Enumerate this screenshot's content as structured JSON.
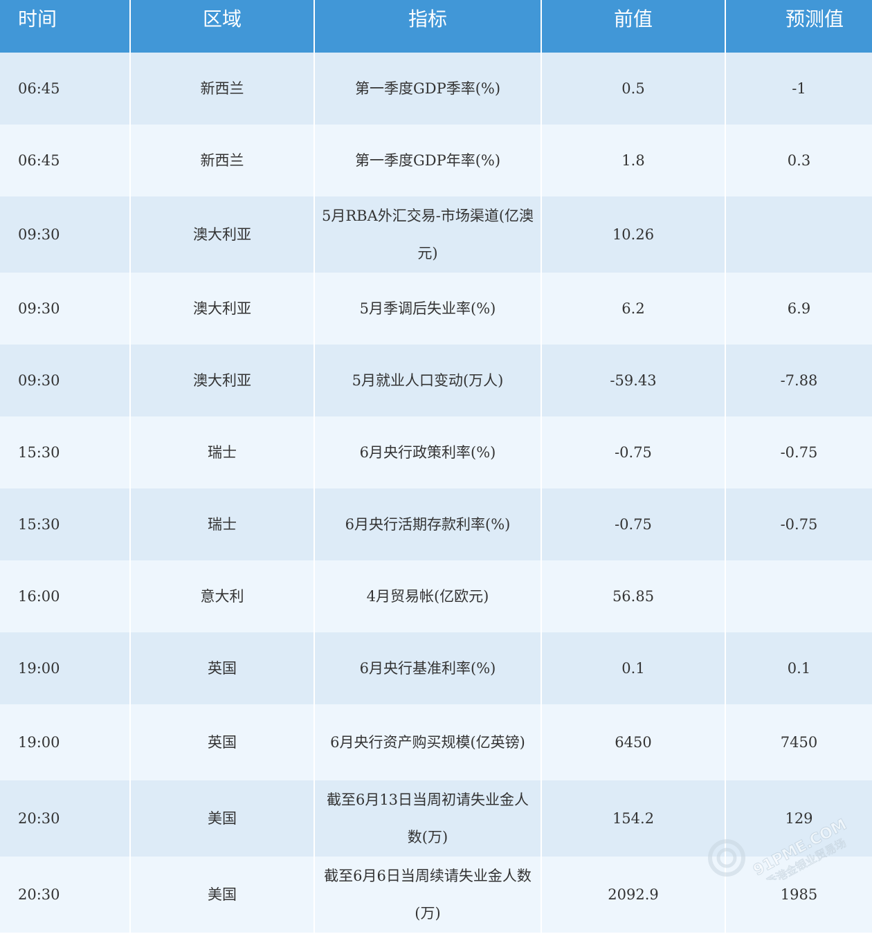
{
  "headers": [
    "时间",
    "区域",
    "指标",
    "前值",
    "预测值"
  ],
  "rows": [
    {
      "time": "06:45",
      "region": "新西兰",
      "indicator": "第一季度GDP季率(%)",
      "previous": "0.5",
      "forecast": "-1"
    },
    {
      "time": "06:45",
      "region": "新西兰",
      "indicator": "第一季度GDP年率(%)",
      "previous": "1.8",
      "forecast": "0.3"
    },
    {
      "time": "09:30",
      "region": "澳大利亚",
      "indicator": "5月RBA外汇交易-市场渠道(亿澳元)",
      "previous": "10.26",
      "forecast": ""
    },
    {
      "time": "09:30",
      "region": "澳大利亚",
      "indicator": "5月季调后失业率(%)",
      "previous": "6.2",
      "forecast": "6.9"
    },
    {
      "time": "09:30",
      "region": "澳大利亚",
      "indicator": "5月就业人口变动(万人)",
      "previous": "-59.43",
      "forecast": "-7.88"
    },
    {
      "time": "15:30",
      "region": "瑞士",
      "indicator": "6月央行政策利率(%)",
      "previous": "-0.75",
      "forecast": "-0.75"
    },
    {
      "time": "15:30",
      "region": "瑞士",
      "indicator": "6月央行活期存款利率(%)",
      "previous": "-0.75",
      "forecast": "-0.75"
    },
    {
      "time": "16:00",
      "region": "意大利",
      "indicator": "4月贸易帐(亿欧元)",
      "previous": "56.85",
      "forecast": ""
    },
    {
      "time": "19:00",
      "region": "英国",
      "indicator": "6月央行基准利率(%)",
      "previous": "0.1",
      "forecast": "0.1"
    },
    {
      "time": "19:00",
      "region": "英国",
      "indicator": "6月央行资产购买规模(亿英镑)",
      "previous": "6450",
      "forecast": "7450"
    },
    {
      "time": "20:30",
      "region": "美国",
      "indicator": "截至6月13日当周初请失业金人数(万)",
      "previous": "154.2",
      "forecast": "129"
    },
    {
      "time": "20:30",
      "region": "美国",
      "indicator": "截至6月6日当周续请失业金人数(万)",
      "previous": "2092.9",
      "forecast": "1985"
    }
  ],
  "watermark": {
    "brand": "91PME.COM",
    "sub": "香港金银业贸易场"
  },
  "icons": {
    "watermark_logo": "circle-logo-icon"
  },
  "colors": {
    "header_bg": "#4197d7",
    "row_odd": "#ddebf7",
    "row_even": "#eef6fd",
    "text": "#333333"
  }
}
